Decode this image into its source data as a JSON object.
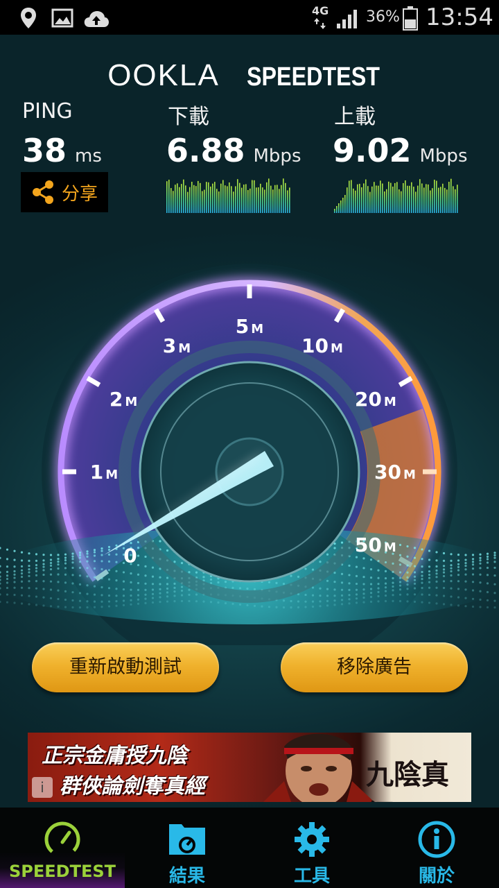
{
  "status_bar": {
    "network": "4G",
    "battery": "36%",
    "time": "13:54",
    "icons": [
      "location-icon",
      "image-icon",
      "cloud-upload-icon",
      "signal-icon",
      "battery-icon"
    ]
  },
  "header": {
    "brand_left": "OOKLA",
    "brand_right": "SPEEDTEST"
  },
  "stats": {
    "ping": {
      "label": "PING",
      "value": "38",
      "unit": "ms"
    },
    "download": {
      "label": "下載",
      "value": "6.88",
      "unit": "Mbps"
    },
    "upload": {
      "label": "上載",
      "value": "9.02",
      "unit": "Mbps"
    }
  },
  "share_button": {
    "label": "分享",
    "icon": "share-icon"
  },
  "gauge": {
    "labels": [
      {
        "num": "0",
        "unit": ""
      },
      {
        "num": "1",
        "unit": "M"
      },
      {
        "num": "2",
        "unit": "M"
      },
      {
        "num": "3",
        "unit": "M"
      },
      {
        "num": "5",
        "unit": "M"
      },
      {
        "num": "10",
        "unit": "M"
      },
      {
        "num": "20",
        "unit": "M"
      },
      {
        "num": "30",
        "unit": "M"
      },
      {
        "num": "50",
        "unit": "M"
      }
    ]
  },
  "buttons": {
    "restart_label": "重新啟動測試",
    "remove_ads_label": "移除廣告"
  },
  "ad": {
    "line1": "正宗金庸授九陰",
    "line2": "群俠論劍奪真經",
    "brand": "九陰真經",
    "info_glyph": "i"
  },
  "bottom_nav": [
    {
      "label": "SPEEDTEST",
      "icon": "speedometer-icon",
      "active": true
    },
    {
      "label": "結果",
      "icon": "results-folder-icon",
      "active": false
    },
    {
      "label": "工具",
      "icon": "gear-icon",
      "active": false
    },
    {
      "label": "關於",
      "icon": "info-icon",
      "active": false
    }
  ],
  "colors": {
    "accent_gold": "#f3a51d",
    "nav_blue": "#29b9e8",
    "nav_active": "#9bd13a",
    "gauge_purple": "#8a4fd0",
    "gauge_orange": "#e98a2a"
  }
}
